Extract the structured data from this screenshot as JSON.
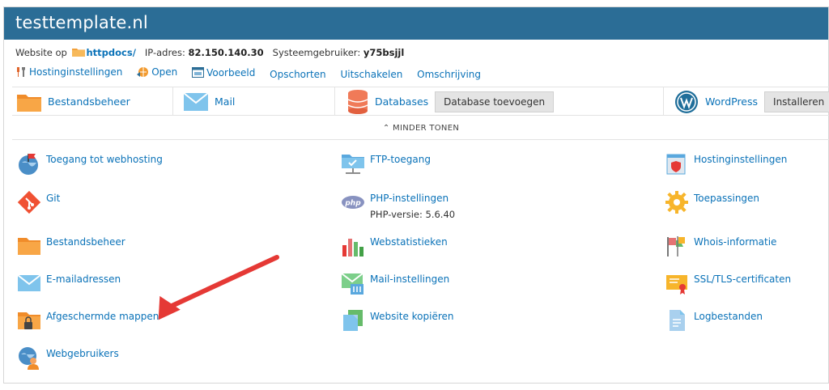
{
  "header": {
    "title": "testtemplate.nl"
  },
  "info": {
    "website_prefix": "Website op",
    "httpdocs": "httpdocs/",
    "ip_label": "IP-adres:",
    "ip_value": "82.150.140.30",
    "sysuser_label": "Systeemgebruiker:",
    "sysuser_value": "y75bsjjl"
  },
  "actions": [
    {
      "label": "Hostinginstellingen",
      "icon": "tools-icon"
    },
    {
      "label": "Open",
      "icon": "globe-open-icon"
    },
    {
      "label": "Voorbeeld",
      "icon": "preview-icon"
    },
    {
      "label": "Opschorten"
    },
    {
      "label": "Uitschakelen"
    },
    {
      "label": "Omschrijving"
    }
  ],
  "tiles": {
    "files": "Bestandsbeheer",
    "mail": "Mail",
    "databases": "Databases",
    "add_db": "Database toevoegen",
    "wordpress": "WordPress",
    "install": "Installeren"
  },
  "less_toggle": "MINDER TONEN",
  "grid": {
    "col1": [
      "Toegang tot webhosting",
      "Git",
      "Bestandsbeheer",
      "E-mailadressen",
      "Afgeschermde mappen",
      "Webgebruikers"
    ],
    "col2": [
      "FTP-toegang",
      "PHP-instellingen",
      "Webstatistieken",
      "Mail-instellingen",
      "Website kopiëren"
    ],
    "col3": [
      "Hostinginstellingen",
      "Toepassingen",
      "Whois-informatie",
      "SSL/TLS-certificaten",
      "Logbestanden"
    ],
    "php_version": "PHP-versie: 5.6.40"
  },
  "colors": {
    "header": "#2b6d96",
    "link": "#0a72b8",
    "arrow": "#e53935"
  }
}
